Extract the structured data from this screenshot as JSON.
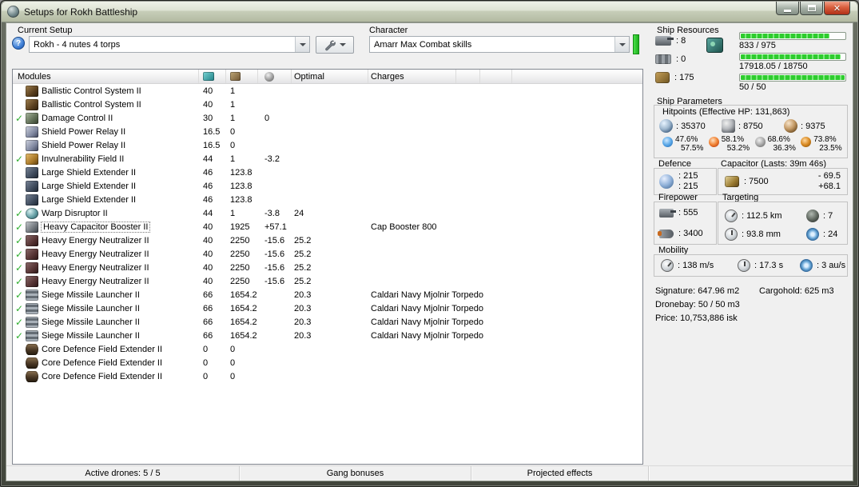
{
  "window": {
    "title": "Setups for Rokh Battleship"
  },
  "setup": {
    "label": "Current Setup",
    "value": "Rokh - 4 nutes 4 torps"
  },
  "character": {
    "label": "Character",
    "value": "Amarr Max Combat skills"
  },
  "resources": {
    "label": "Ship Resources",
    "slots": [
      {
        "icon": "turret-hardpoints-icon",
        "value": ": 8"
      },
      {
        "icon": "launcher-hardpoints-icon",
        "value": ": 0"
      },
      {
        "icon": "calibration-icon",
        "value": ": 175"
      }
    ],
    "bars": [
      {
        "name": "cpu-bar",
        "text": "833 / 975",
        "pct": 85
      },
      {
        "name": "powergrid-bar",
        "text": "17918.05 / 18750",
        "pct": 96
      },
      {
        "name": "drone-bar",
        "text": "50 / 50",
        "pct": 100
      }
    ]
  },
  "modules": {
    "columns": {
      "modules": "Modules",
      "optimal": "Optimal",
      "charges": "Charges"
    },
    "rows": [
      {
        "active": false,
        "icon": "ballistic-control-icon",
        "name": "Ballistic Control System II",
        "cpu": "40",
        "pg": "1",
        "cap": "",
        "optimal": "",
        "charges": ""
      },
      {
        "active": false,
        "icon": "ballistic-control-icon",
        "name": "Ballistic Control System II",
        "cpu": "40",
        "pg": "1",
        "cap": "",
        "optimal": "",
        "charges": ""
      },
      {
        "active": true,
        "icon": "damage-control-icon",
        "name": "Damage Control II",
        "cpu": "30",
        "pg": "1",
        "cap": "0",
        "optimal": "",
        "charges": ""
      },
      {
        "active": false,
        "icon": "shield-power-relay-icon",
        "name": "Shield Power Relay II",
        "cpu": "16.5",
        "pg": "0",
        "cap": "",
        "optimal": "",
        "charges": ""
      },
      {
        "active": false,
        "icon": "shield-power-relay-icon",
        "name": "Shield Power Relay II",
        "cpu": "16.5",
        "pg": "0",
        "cap": "",
        "optimal": "",
        "charges": ""
      },
      {
        "active": true,
        "icon": "invulnerability-field-icon",
        "name": "Invulnerability Field II",
        "cpu": "44",
        "pg": "1",
        "cap": "-3.2",
        "optimal": "",
        "charges": ""
      },
      {
        "active": false,
        "icon": "shield-extender-icon",
        "name": "Large Shield Extender II",
        "cpu": "46",
        "pg": "123.8",
        "cap": "",
        "optimal": "",
        "charges": ""
      },
      {
        "active": false,
        "icon": "shield-extender-icon",
        "name": "Large Shield Extender II",
        "cpu": "46",
        "pg": "123.8",
        "cap": "",
        "optimal": "",
        "charges": ""
      },
      {
        "active": false,
        "icon": "shield-extender-icon",
        "name": "Large Shield Extender II",
        "cpu": "46",
        "pg": "123.8",
        "cap": "",
        "optimal": "",
        "charges": ""
      },
      {
        "active": true,
        "icon": "warp-disruptor-icon",
        "name": "Warp Disruptor II",
        "cpu": "44",
        "pg": "1",
        "cap": "-3.8",
        "optimal": "24",
        "charges": ""
      },
      {
        "active": true,
        "selected": true,
        "icon": "capacitor-booster-icon",
        "name": "Heavy Capacitor Booster II",
        "cpu": "40",
        "pg": "1925",
        "cap": "+57.1",
        "optimal": "",
        "charges": "Cap Booster 800"
      },
      {
        "active": true,
        "icon": "energy-neutralizer-icon",
        "name": "Heavy Energy Neutralizer II",
        "cpu": "40",
        "pg": "2250",
        "cap": "-15.6",
        "optimal": "25.2",
        "charges": ""
      },
      {
        "active": true,
        "icon": "energy-neutralizer-icon",
        "name": "Heavy Energy Neutralizer II",
        "cpu": "40",
        "pg": "2250",
        "cap": "-15.6",
        "optimal": "25.2",
        "charges": ""
      },
      {
        "active": true,
        "icon": "energy-neutralizer-icon",
        "name": "Heavy Energy Neutralizer II",
        "cpu": "40",
        "pg": "2250",
        "cap": "-15.6",
        "optimal": "25.2",
        "charges": ""
      },
      {
        "active": true,
        "icon": "energy-neutralizer-icon",
        "name": "Heavy Energy Neutralizer II",
        "cpu": "40",
        "pg": "2250",
        "cap": "-15.6",
        "optimal": "25.2",
        "charges": ""
      },
      {
        "active": true,
        "icon": "missile-launcher-icon",
        "name": "Siege Missile Launcher II",
        "cpu": "66",
        "pg": "1654.2",
        "cap": "",
        "optimal": "20.3",
        "charges": "Caldari Navy Mjolnir Torpedo"
      },
      {
        "active": true,
        "icon": "missile-launcher-icon",
        "name": "Siege Missile Launcher II",
        "cpu": "66",
        "pg": "1654.2",
        "cap": "",
        "optimal": "20.3",
        "charges": "Caldari Navy Mjolnir Torpedo"
      },
      {
        "active": true,
        "icon": "missile-launcher-icon",
        "name": "Siege Missile Launcher II",
        "cpu": "66",
        "pg": "1654.2",
        "cap": "",
        "optimal": "20.3",
        "charges": "Caldari Navy Mjolnir Torpedo"
      },
      {
        "active": true,
        "icon": "missile-launcher-icon",
        "name": "Siege Missile Launcher II",
        "cpu": "66",
        "pg": "1654.2",
        "cap": "",
        "optimal": "20.3",
        "charges": "Caldari Navy Mjolnir Torpedo"
      },
      {
        "active": false,
        "icon": "rig-icon",
        "name": "Core Defence Field Extender II",
        "cpu": "0",
        "pg": "0",
        "cap": "",
        "optimal": "",
        "charges": ""
      },
      {
        "active": false,
        "icon": "rig-icon",
        "name": "Core Defence Field Extender II",
        "cpu": "0",
        "pg": "0",
        "cap": "",
        "optimal": "",
        "charges": ""
      },
      {
        "active": false,
        "icon": "rig-icon",
        "name": "Core Defence Field Extender II",
        "cpu": "0",
        "pg": "0",
        "cap": "",
        "optimal": "",
        "charges": ""
      }
    ]
  },
  "parameters": {
    "label": "Ship Parameters",
    "hitpoints": {
      "title": "Hitpoints (Effective HP: 131,863)",
      "hp": [
        {
          "icon": "shield-hp-icon",
          "value": ": 35370"
        },
        {
          "icon": "armor-hp-icon",
          "value": ": 8750"
        },
        {
          "icon": "hull-hp-icon",
          "value": ": 9375"
        }
      ],
      "resists": [
        {
          "icon": "em-damage-icon",
          "shield": "47.6%",
          "armor": "57.5%"
        },
        {
          "icon": "thermal-damage-icon",
          "shield": "58.1%",
          "armor": "53.2%"
        },
        {
          "icon": "kinetic-damage-icon",
          "shield": "68.6%",
          "armor": "36.3%"
        },
        {
          "icon": "explosive-damage-icon",
          "shield": "73.8%",
          "armor": "23.5%"
        }
      ]
    },
    "defence": {
      "title": "Defence",
      "value1": ": 215",
      "value2": ": 215"
    },
    "capacitor": {
      "title": "Capacitor (Lasts: 39m 46s)",
      "amount": ": 7500",
      "drain": "- 69.5",
      "boost": "+68.1"
    },
    "firepower": {
      "title": "Firepower",
      "turret": ": 555",
      "missile": ": 3400"
    },
    "targeting": {
      "title": "Targeting",
      "range": ": 112.5 km",
      "max_targets": ": 7",
      "scan_resolution": ": 93.8 mm",
      "sensor_strength": ": 24"
    },
    "mobility": {
      "title": "Mobility",
      "max_velocity": ": 138 m/s",
      "align_time": ": 17.3 s",
      "warp_speed": ": 3 au/s"
    },
    "signature": "Signature: 647.96 m2",
    "cargohold": "Cargohold: 625 m3",
    "dronebay": "Dronebay: 50 / 50 m3",
    "price": "Price: 10,753,886 isk"
  },
  "statusbar": {
    "drones": "Active drones: 5 / 5",
    "gang": "Gang bonuses",
    "projected": "Projected effects"
  }
}
